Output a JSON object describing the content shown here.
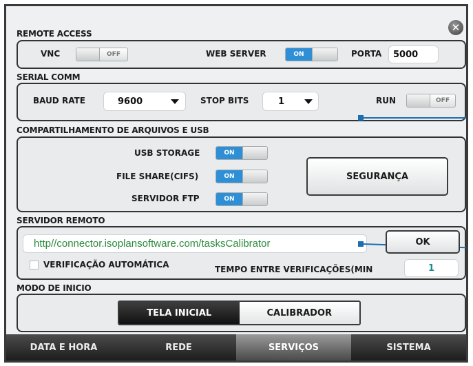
{
  "remote_access": {
    "title": "REMOTE ACCESS",
    "vnc_label": "VNC",
    "vnc_state": "OFF",
    "web_server_label": "WEB SERVER",
    "web_server_state": "ON",
    "porta_label": "PORTA",
    "porta_value": "5000"
  },
  "serial_comm": {
    "title": "SERIAL COMM",
    "baud_rate_label": "BAUD RATE",
    "baud_rate_value": "9600",
    "stop_bits_label": "STOP BITS",
    "stop_bits_value": "1",
    "run_label": "RUN",
    "run_state": "OFF"
  },
  "file_sharing": {
    "title": "COMPARTILHAMENTO DE ARQUIVOS E USB",
    "usb_storage_label": "USB STORAGE",
    "usb_storage_state": "ON",
    "file_share_label": "FILE SHARE(CIFS)",
    "file_share_state": "ON",
    "ftp_label": "SERVIDOR FTP",
    "ftp_state": "ON",
    "security_button": "SEGURANÇA"
  },
  "remote_server": {
    "title": "SERVIDOR REMOTO",
    "url": "http//connector.isoplansoftware.com/tasksCalibrator",
    "ok_button": "OK",
    "auto_check_label": "VERIFICAÇÃO AUTOMÁTICA",
    "interval_label": "TEMPO ENTRE VERIFICAÇÕES(MIN",
    "interval_value": "1"
  },
  "start_mode": {
    "title": "MODO DE INICIO",
    "options": [
      "TELA INICIAL",
      "CALIBRADOR"
    ],
    "selected": "TELA INICIAL"
  },
  "nav": {
    "tabs": [
      "DATA E HORA",
      "REDE",
      "SERVIÇOS",
      "SISTEMA"
    ],
    "active": "SERVIÇOS"
  },
  "colors": {
    "accent": "#2e8fd6",
    "nav_bg": "#2a2a2a",
    "annotation": "#1a6fb2"
  }
}
